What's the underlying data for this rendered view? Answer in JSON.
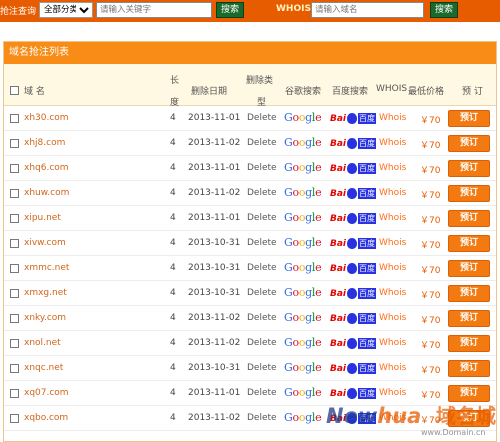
{
  "search": {
    "label": "抢注查询",
    "category": "全部分类",
    "keyword_placeholder": "请输入关键字",
    "search_button": "搜索",
    "whois_label": "WHOIS",
    "domain_placeholder": "请输入域名",
    "whois_button": "搜索"
  },
  "panel": {
    "title": "域名抢注列表"
  },
  "columns": {
    "domain": "域  名",
    "length_1": "长",
    "length_2": "度",
    "date": "删除日期",
    "type_1": "删除类",
    "type_2": "型",
    "google": "谷歌搜索",
    "baidu": "百度搜索",
    "whois": "WHOIS",
    "price": "最低价格",
    "order": "预  订"
  },
  "logos": {
    "google": "Google",
    "baidu_bai": "Bai",
    "baidu_du": "百度"
  },
  "rows": [
    {
      "domain": "xh30.com",
      "length": "4",
      "date": "2013-11-01",
      "type": "Delete",
      "whois": "Whois",
      "price": "￥70",
      "order": "预订"
    },
    {
      "domain": "xhj8.com",
      "length": "4",
      "date": "2013-11-02",
      "type": "Delete",
      "whois": "Whois",
      "price": "￥70",
      "order": "预订"
    },
    {
      "domain": "xhq6.com",
      "length": "4",
      "date": "2013-11-01",
      "type": "Delete",
      "whois": "Whois",
      "price": "￥70",
      "order": "预订"
    },
    {
      "domain": "xhuw.com",
      "length": "4",
      "date": "2013-11-02",
      "type": "Delete",
      "whois": "Whois",
      "price": "￥70",
      "order": "预订"
    },
    {
      "domain": "xipu.net",
      "length": "4",
      "date": "2013-11-01",
      "type": "Delete",
      "whois": "Whois",
      "price": "￥70",
      "order": "预订"
    },
    {
      "domain": "xivw.com",
      "length": "4",
      "date": "2013-10-31",
      "type": "Delete",
      "whois": "Whois",
      "price": "￥70",
      "order": "预订"
    },
    {
      "domain": "xmmc.net",
      "length": "4",
      "date": "2013-10-31",
      "type": "Delete",
      "whois": "Whois",
      "price": "￥70",
      "order": "预订"
    },
    {
      "domain": "xmxg.net",
      "length": "4",
      "date": "2013-10-31",
      "type": "Delete",
      "whois": "Whois",
      "price": "￥70",
      "order": "预订"
    },
    {
      "domain": "xnky.com",
      "length": "4",
      "date": "2013-11-02",
      "type": "Delete",
      "whois": "Whois",
      "price": "￥70",
      "order": "预订"
    },
    {
      "domain": "xnol.net",
      "length": "4",
      "date": "2013-11-02",
      "type": "Delete",
      "whois": "Whois",
      "price": "￥70",
      "order": "预订"
    },
    {
      "domain": "xnqc.net",
      "length": "4",
      "date": "2013-10-31",
      "type": "Delete",
      "whois": "Whois",
      "price": "￥70",
      "order": "预订"
    },
    {
      "domain": "xq07.com",
      "length": "4",
      "date": "2013-11-01",
      "type": "Delete",
      "whois": "Whois",
      "price": "￥70",
      "order": "预订"
    },
    {
      "domain": "xqbo.com",
      "length": "4",
      "date": "2013-11-02",
      "type": "Delete",
      "whois": "Whois",
      "price": "￥70",
      "order": "预订"
    }
  ],
  "watermark": {
    "brand_a": "New",
    "brand_b": "hua",
    "cn": "域名城",
    "url": "www.Domain.cn"
  }
}
